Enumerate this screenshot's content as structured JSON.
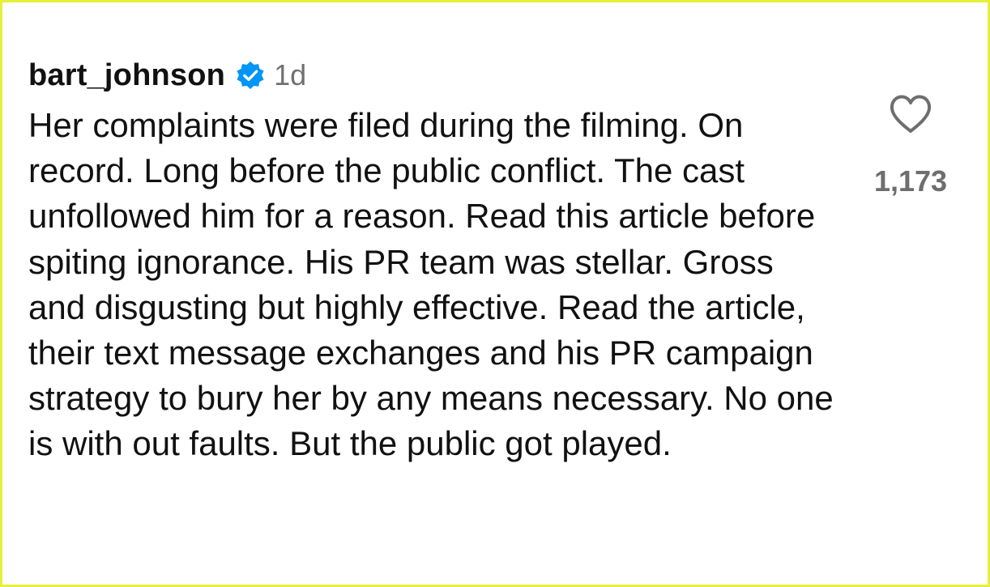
{
  "comment": {
    "username": "bart_johnson",
    "timestamp": "1d",
    "verified_icon": "verified-badge-icon",
    "text": "Her complaints were filed during the filming. On record. Long before the public conflict. The cast unfollowed him for a reason. Read this article before spiting ignorance. His PR team was stellar. Gross and disgusting but highly effective. Read the article, their text message exchanges and his PR campaign strategy to bury her by any means necessary. No one is with out faults. But the public got played."
  },
  "like": {
    "icon": "heart-icon",
    "count": "1,173"
  },
  "colors": {
    "frame_border": "#e6f03a",
    "verified_blue": "#0095f6",
    "text": "#111111",
    "muted": "#707070"
  }
}
